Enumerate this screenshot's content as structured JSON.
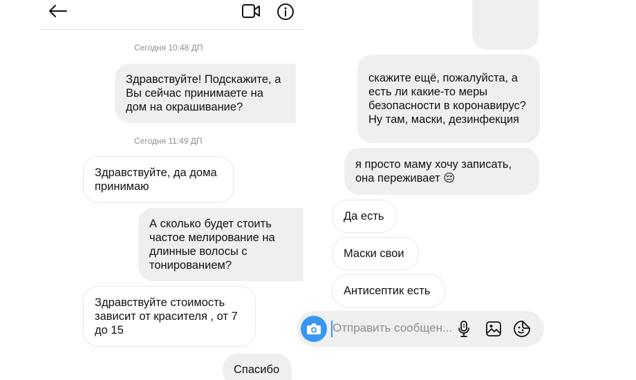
{
  "left": {
    "messages": [
      {
        "kind": "timestamp",
        "text": "Сегодня 10:48 ДП"
      },
      {
        "kind": "outgoing",
        "text": "Здравствуйте! Подскажите, а Вы сейчас принимаете на дом на окрашивание?"
      },
      {
        "kind": "timestamp",
        "text": "Сегодня 11:49 ДП"
      },
      {
        "kind": "incoming",
        "text": "Здравствуйте, да дома принимаю"
      },
      {
        "kind": "outgoing",
        "text": "А сколько будет стоить частое мелирование на длинные волосы с тонированием?"
      },
      {
        "kind": "incoming",
        "text": "Здравствуйте стоимость зависит от красителя , от 7 до 15"
      },
      {
        "kind": "outgoing",
        "text": "Спасибо"
      }
    ]
  },
  "right": {
    "messages": [
      {
        "kind": "outgoing",
        "text": "скажите ещё, пожалуйста, а есть ли какие-то меры безопасности в коронавирус? Ну там, маски, дезинфекция"
      },
      {
        "kind": "outgoing",
        "text": "я просто маму хочу записать, она переживает 😔"
      },
      {
        "kind": "incoming",
        "text": "Да есть"
      },
      {
        "kind": "incoming",
        "text": "Маски свои"
      },
      {
        "kind": "incoming",
        "text": "Антисептик есть"
      }
    ],
    "composer": {
      "placeholder": "Отправить сообщен..."
    }
  },
  "icons": {
    "back": "back-arrow-icon",
    "video": "video-call-icon",
    "info": "info-icon",
    "camera": "camera-icon",
    "mic": "microphone-icon",
    "gallery": "gallery-icon",
    "sticker": "sticker-icon"
  },
  "colors": {
    "outgoing_bubble": "#efefef",
    "incoming_border": "#e6e6e6",
    "camera_button": "#3897f0",
    "timestamp": "#8e8e8e"
  }
}
